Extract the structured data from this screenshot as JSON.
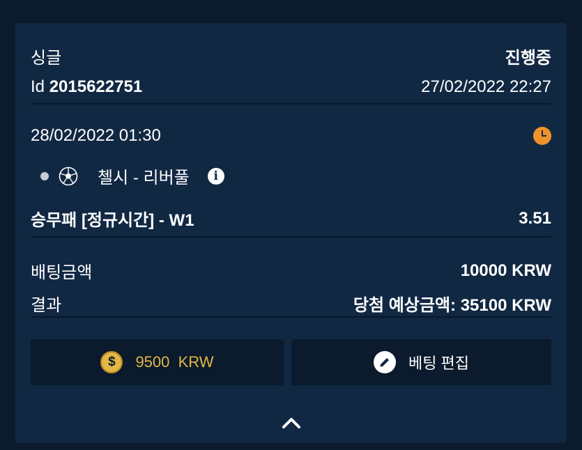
{
  "header": {
    "bet_type": "싱글",
    "status": "진행중",
    "id_label": "Id",
    "id_value": "2015622751",
    "placed_datetime": "27/02/2022 22:27"
  },
  "event": {
    "start_datetime": "28/02/2022 01:30",
    "match": "첼시 - 리버풀",
    "market": "승무패 [정규시간] - W1",
    "odds": "3.51"
  },
  "summary": {
    "stake_label": "배팅금액",
    "stake_value": "10000 KRW",
    "result_label": "결과",
    "result_value": "당첨 예상금액: 35100 KRW"
  },
  "actions": {
    "cashout_amount": "9500  KRW",
    "edit_label": "베팅 편집"
  },
  "icons": {
    "status_icon": "clock-icon",
    "sport_icon": "soccer-ball-icon",
    "info_icon": "info-icon",
    "cashout_icon": "dollar-coin-icon",
    "edit_icon": "pencil-icon",
    "collapse_icon": "chevron-up-icon"
  },
  "colors": {
    "background": "#0b1a2c",
    "card": "#112843",
    "accent_orange": "#f0922b",
    "accent_gold": "#e2b746"
  }
}
